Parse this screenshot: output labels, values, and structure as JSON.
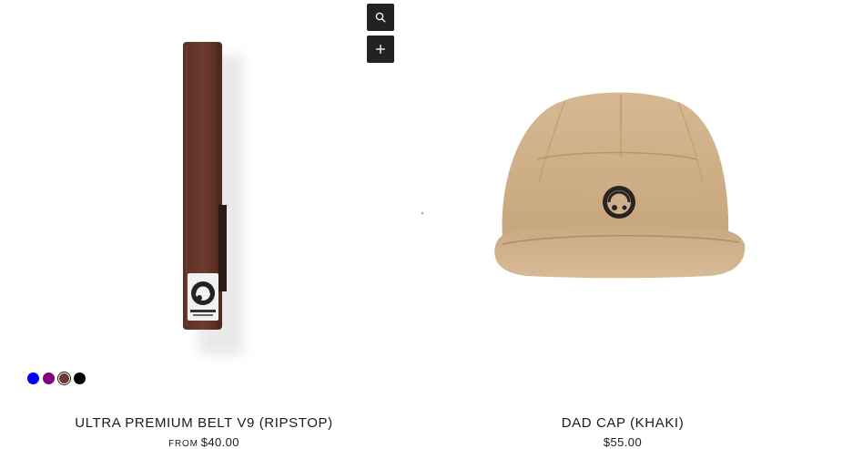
{
  "products": [
    {
      "title": "ULTRA PREMIUM BELT V9 (RIPSTOP)",
      "price_prefix": "FROM",
      "price": "$40.00",
      "image_icon": "brown-belt-image",
      "swatches": [
        {
          "color": "#0000ff",
          "name": "blue"
        },
        {
          "color": "#800080",
          "name": "purple"
        },
        {
          "color": "#6b3a2e",
          "name": "brown",
          "selected": true
        },
        {
          "color": "#000000",
          "name": "black"
        }
      ]
    },
    {
      "title": "DAD CAP (KHAKI)",
      "price": "$55.00",
      "image_icon": "khaki-cap-image"
    }
  ],
  "actions": {
    "quick_view_icon": "search-icon",
    "quick_add_icon": "plus-icon"
  },
  "colors": {
    "button_bg": "#222222",
    "belt": "#6b3a2e",
    "cap": "#d0b08a"
  }
}
